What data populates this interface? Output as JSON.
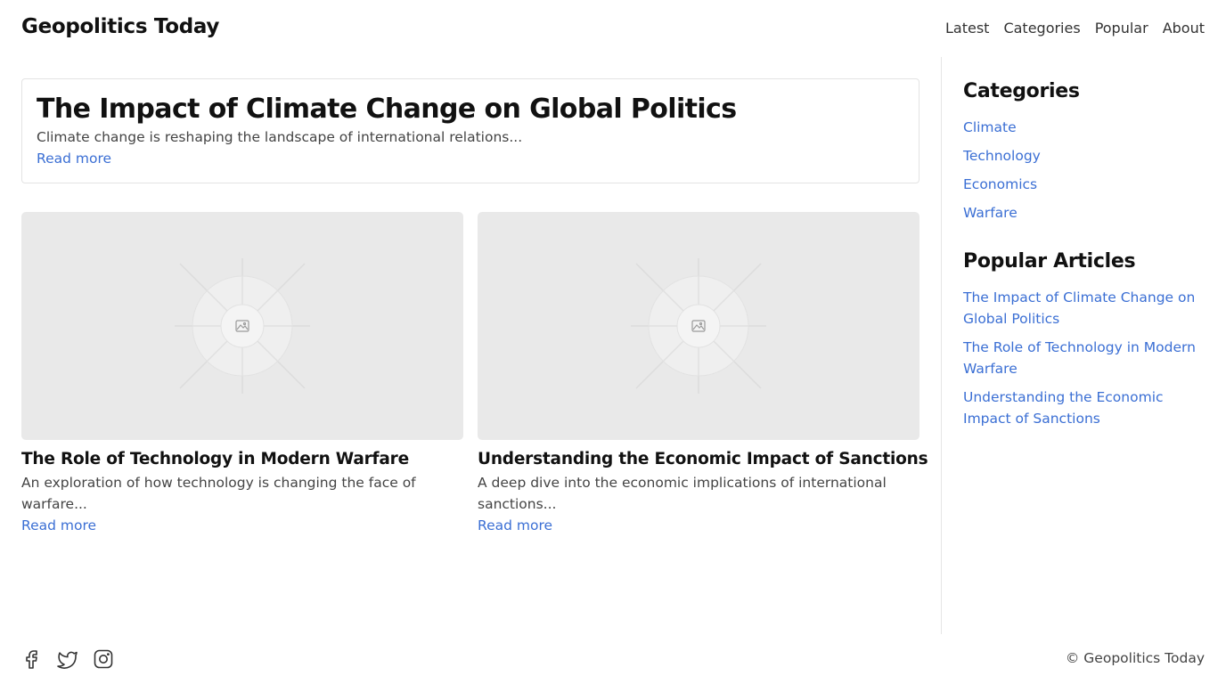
{
  "header": {
    "site_title": "Geopolitics Today",
    "nav": [
      "Latest",
      "Categories",
      "Popular",
      "About"
    ]
  },
  "featured": {
    "title": "The Impact of Climate Change on Global Politics",
    "excerpt": "Climate change is reshaping the landscape of international relations...",
    "read_more": "Read more"
  },
  "articles": [
    {
      "title": "The Role of Technology in Modern Warfare",
      "excerpt": "An exploration of how technology is changing the face of warfare...",
      "read_more": "Read more",
      "image_icon": "image-placeholder-icon"
    },
    {
      "title": "Understanding the Economic Impact of Sanctions",
      "excerpt": "A deep dive into the economic implications of international sanctions...",
      "read_more": "Read more",
      "image_icon": "image-placeholder-icon"
    }
  ],
  "sidebar": {
    "categories_heading": "Categories",
    "categories": [
      "Climate",
      "Technology",
      "Economics",
      "Warfare"
    ],
    "popular_heading": "Popular Articles",
    "popular": [
      "The Impact of Climate Change on Global Politics",
      "The Role of Technology in Modern Warfare",
      "Understanding the Economic Impact of Sanctions"
    ]
  },
  "footer": {
    "social_icons": [
      "facebook-icon",
      "twitter-icon",
      "instagram-icon"
    ],
    "copyright": "© Geopolitics Today"
  },
  "colors": {
    "link": "#3b6fd4",
    "text": "#111111",
    "muted": "#444444",
    "border": "#e3e3e3",
    "placeholder_bg": "#e9e9e9"
  }
}
